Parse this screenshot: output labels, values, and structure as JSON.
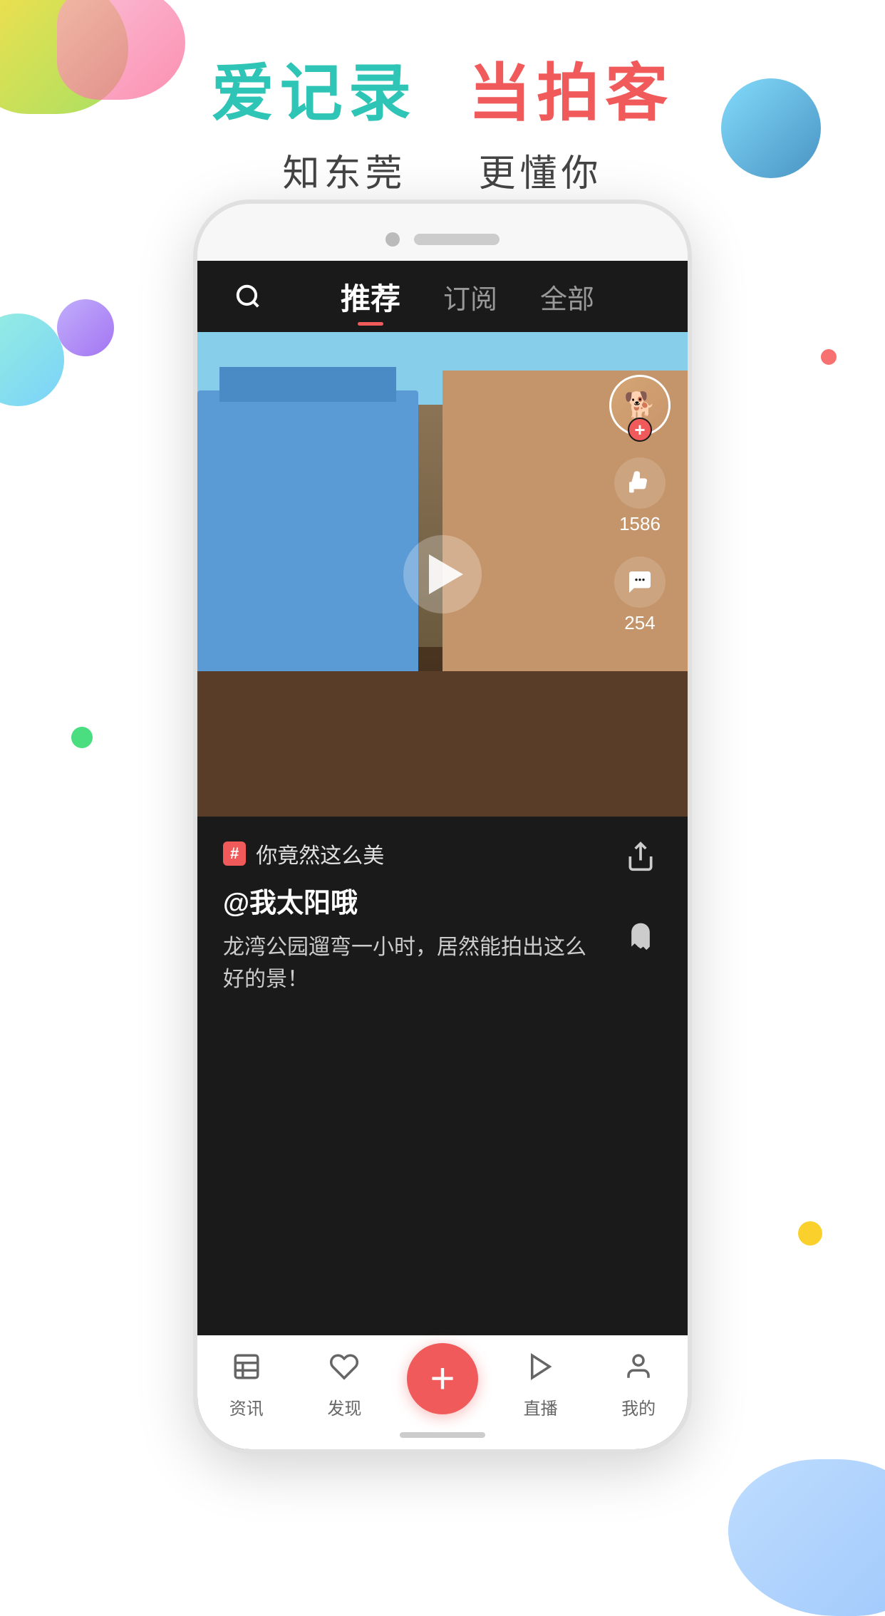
{
  "header": {
    "part1": "爱记录",
    "part2": "当拍客",
    "sub_part1": "知东莞",
    "sub_part2": "更懂你"
  },
  "nav": {
    "search_label": "search",
    "tabs": [
      {
        "label": "推荐",
        "active": true
      },
      {
        "label": "订阅",
        "active": false
      },
      {
        "label": "全部",
        "active": false
      }
    ]
  },
  "video": {
    "play_button_label": "play",
    "like_count": "1586",
    "comment_count": "254"
  },
  "content": {
    "hashtag_badge": "#",
    "hashtag_text": "你竟然这么美",
    "user_mention": "@我太阳哦",
    "description": "龙湾公园遛弯一小时，居然能拍出这么好的景！"
  },
  "bottom_tabs": [
    {
      "icon": "≡",
      "label": "资讯"
    },
    {
      "icon": "♡",
      "label": "发现"
    },
    {
      "icon": "+",
      "label": "",
      "is_add": true
    },
    {
      "icon": "▶",
      "label": "直播"
    },
    {
      "icon": "○",
      "label": "我的"
    }
  ],
  "share_icon": "↗",
  "ghost_icon": "👻",
  "avatar_emoji": "🐕"
}
